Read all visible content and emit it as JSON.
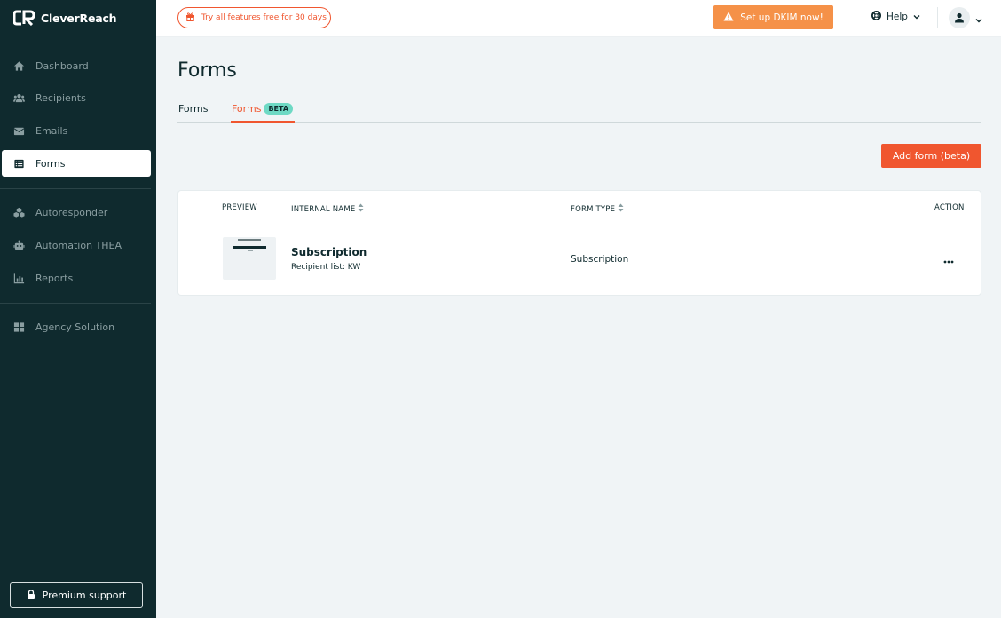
{
  "brand": {
    "name": "CleverReach"
  },
  "sidebar": {
    "items": [
      {
        "label": "Dashboard"
      },
      {
        "label": "Recipients"
      },
      {
        "label": "Emails"
      },
      {
        "label": "Forms"
      },
      {
        "label": "Autoresponder"
      },
      {
        "label": "Automation THEA"
      },
      {
        "label": "Reports"
      },
      {
        "label": "Agency Solution"
      }
    ],
    "premium_label": "Premium support"
  },
  "header": {
    "trial_label": "Try all features free for 30 days",
    "dkim_label": "Set up DKIM now!",
    "help_label": "Help"
  },
  "main": {
    "title": "Forms",
    "tabs": [
      {
        "label": "Forms"
      },
      {
        "label": "Forms",
        "badge": "BETA"
      }
    ],
    "add_button": "Add form (beta)",
    "table": {
      "headers": {
        "preview": "PREVIEW",
        "name": "INTERNAL NAME",
        "type": "FORM TYPE",
        "action": "ACTION"
      },
      "rows": [
        {
          "name": "Subscription",
          "sub": "Recipient list: KW",
          "type": "Subscription"
        }
      ]
    }
  },
  "colors": {
    "sidebar_bg": "#0f2a2e",
    "accent": "#f0562f",
    "warning": "#f59148",
    "beta_badge": "#6ed9c4"
  }
}
